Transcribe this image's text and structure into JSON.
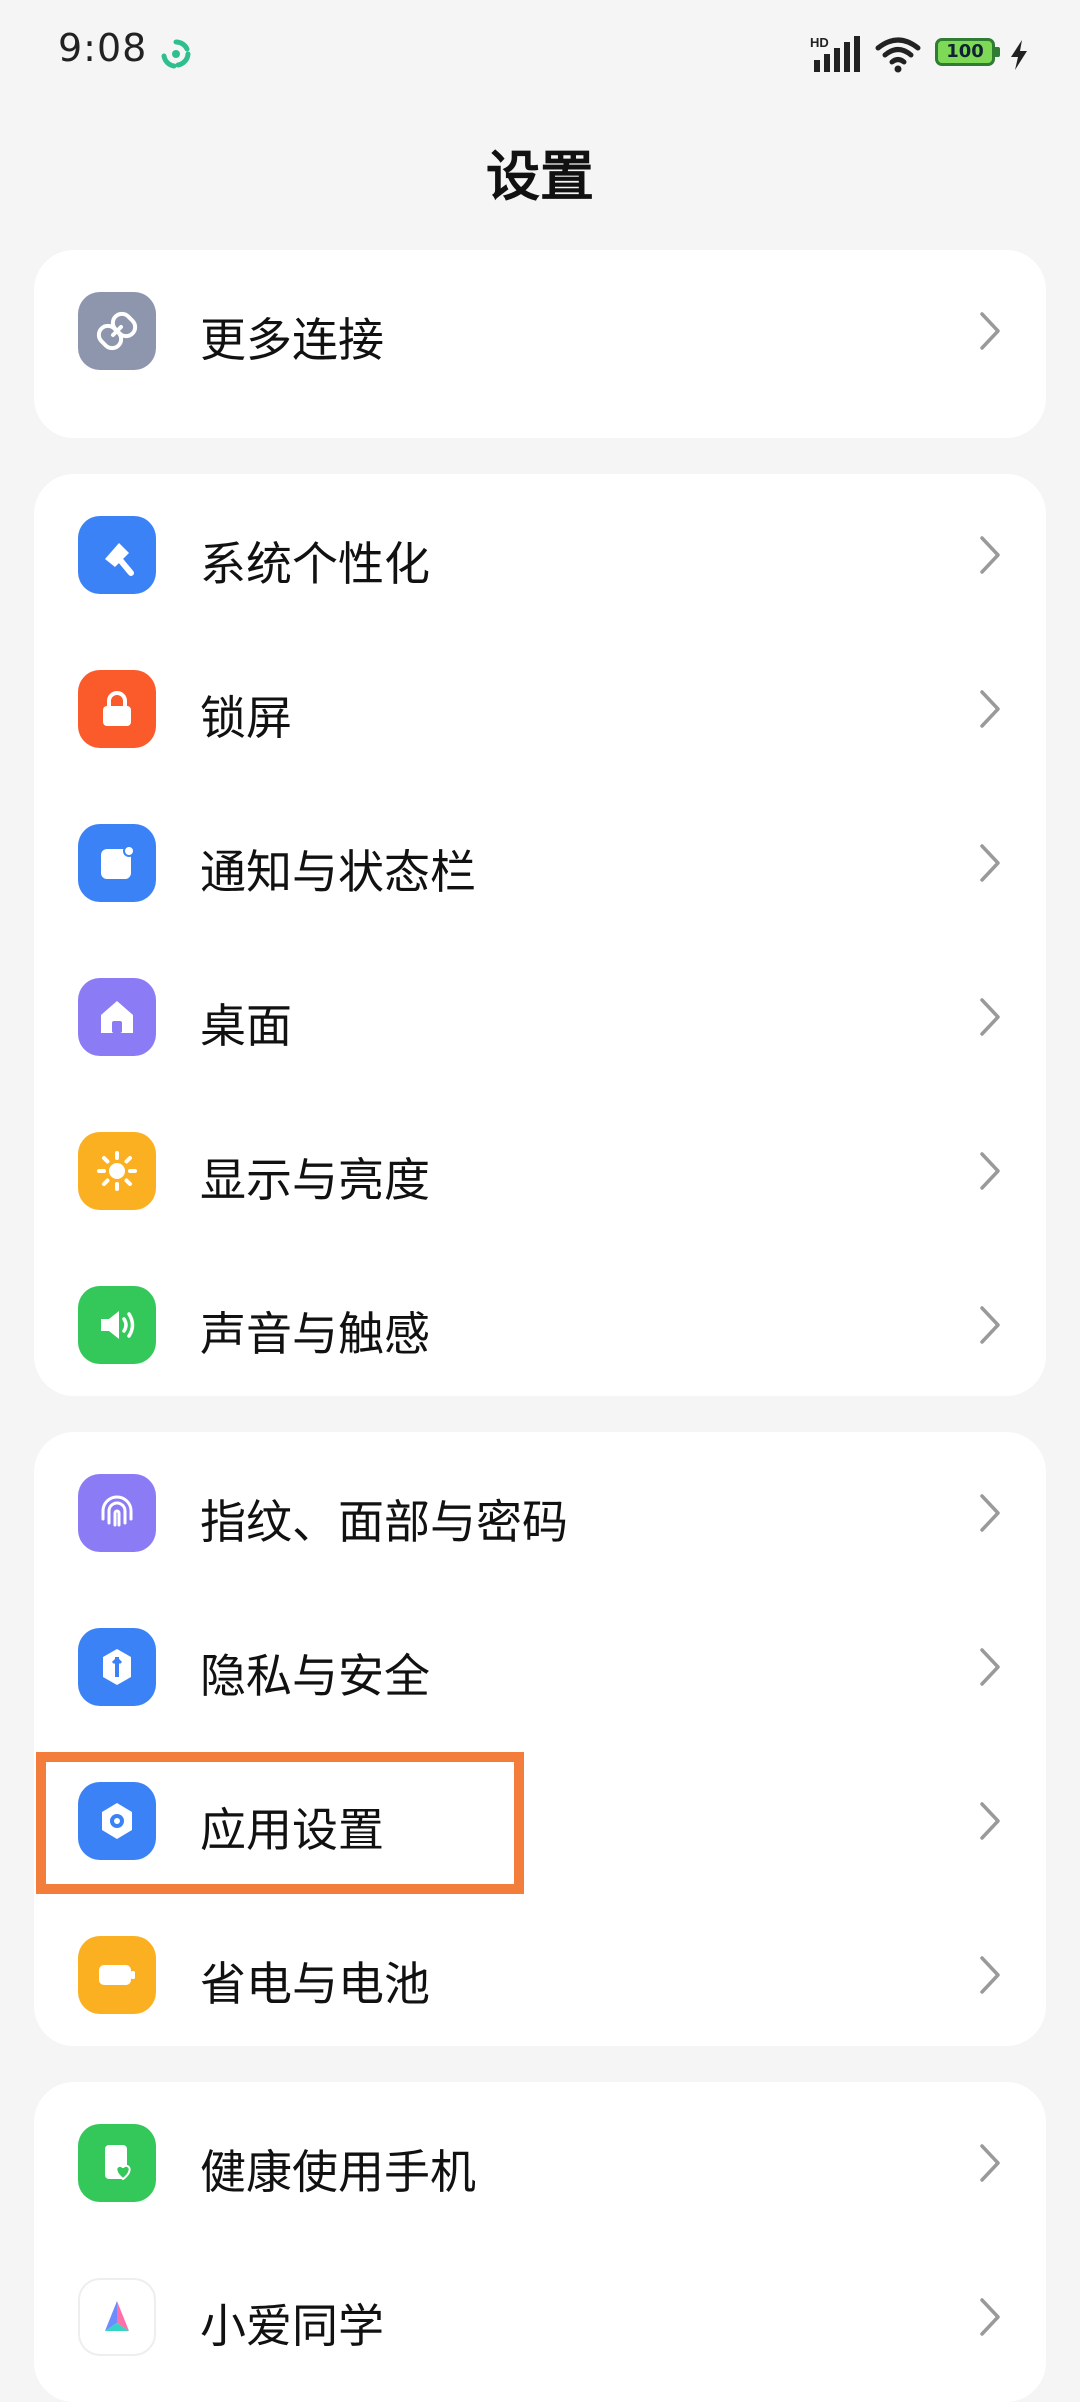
{
  "status_bar": {
    "time": "9:08",
    "battery_level": "100",
    "network_badge": "HD",
    "colors": {
      "battery_fill": "#7ed957",
      "sync_accent": "#2fbf8f"
    }
  },
  "header": {
    "title": "设置"
  },
  "groups": [
    {
      "items": [
        {
          "label": "更多连接",
          "icon": "link-icon",
          "color": "#8e96ad"
        }
      ]
    },
    {
      "items": [
        {
          "label": "系统个性化",
          "icon": "brush-icon",
          "color": "#3b82f6"
        },
        {
          "label": "锁屏",
          "icon": "lock-icon",
          "color": "#fb5a2a"
        },
        {
          "label": "通知与状态栏",
          "icon": "notification-icon",
          "color": "#3b82f6"
        },
        {
          "label": "桌面",
          "icon": "home-icon",
          "color": "#8b7cf6"
        },
        {
          "label": "显示与亮度",
          "icon": "sun-icon",
          "color": "#fbb022"
        },
        {
          "label": "声音与触感",
          "icon": "speaker-icon",
          "color": "#34c759"
        }
      ]
    },
    {
      "items": [
        {
          "label": "指纹、面部与密码",
          "icon": "fingerprint-icon",
          "color": "#8b7cf6"
        },
        {
          "label": "隐私与安全",
          "icon": "privacy-shield-icon",
          "color": "#3b82f6"
        },
        {
          "label": "应用设置",
          "icon": "app-gear-icon",
          "color": "#3b82f6"
        },
        {
          "label": "省电与电池",
          "icon": "battery-saver-icon",
          "color": "#fbb022"
        }
      ]
    },
    {
      "items": [
        {
          "label": "健康使用手机",
          "icon": "phone-health-icon",
          "color": "#34c759"
        },
        {
          "label": "小爱同学",
          "icon": "xiaoai-icon",
          "color": "#ffffff"
        }
      ]
    }
  ],
  "highlight": {
    "target": "应用设置",
    "color": "#f37e3c"
  }
}
